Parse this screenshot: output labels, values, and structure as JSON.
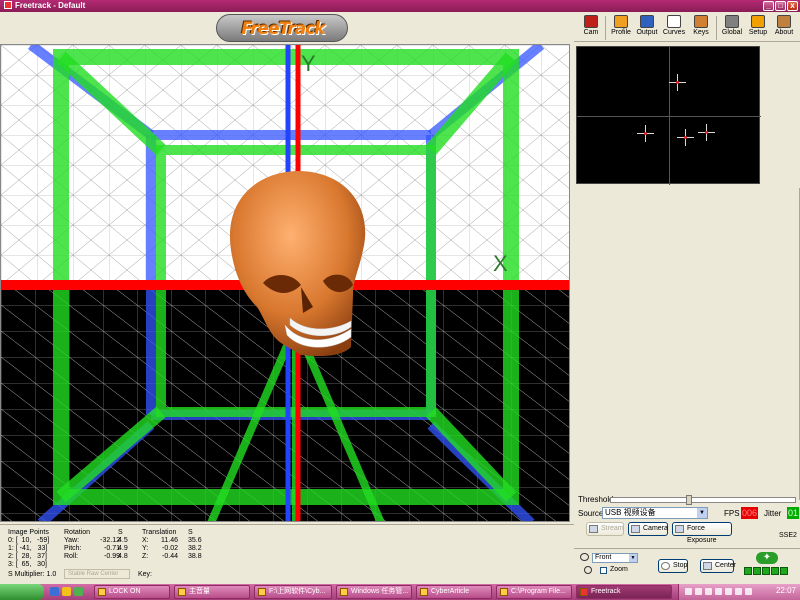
{
  "window": {
    "title": "Freetrack - Default",
    "buttons": [
      "_",
      "□",
      "x"
    ]
  },
  "logo": {
    "text": "FreeTrack"
  },
  "view3d": {
    "axis_y_label": "Y",
    "axis_x_label": "X",
    "colors": {
      "green": "#00cc00",
      "blue": "#2244ff",
      "red": "#ff0000",
      "skull": "#d9782f"
    }
  },
  "toolbar": {
    "items": [
      {
        "label": "Cam",
        "icon": "camera-icon",
        "color": "#c0201a"
      },
      {
        "label": "Profile",
        "icon": "profile-icon",
        "color": "#f0a020"
      },
      {
        "label": "Output",
        "icon": "output-icon",
        "color": "#3060c0"
      },
      {
        "label": "Curves",
        "icon": "curves-icon",
        "color": "#e04040"
      },
      {
        "label": "Keys",
        "icon": "keys-icon",
        "color": "#d08030"
      },
      {
        "label": "Global",
        "icon": "global-icon",
        "color": "#808080"
      },
      {
        "label": "Setup",
        "icon": "setup-icon",
        "color": "#f0a000"
      },
      {
        "label": "About",
        "icon": "about-icon",
        "color": "#c08040"
      }
    ]
  },
  "threshold": {
    "label": "Threshold",
    "level": 0.42
  },
  "source": {
    "label": "Source",
    "value": "USB 视频设备",
    "fps_label": "FPS",
    "fps_value": "006",
    "jitter_label": "Jitter",
    "jitter_value": "01"
  },
  "buttons": {
    "stream": "Stream",
    "camera": "Camera",
    "force_exposure": "Force Exposure",
    "sse2": "SSE2"
  },
  "status": {
    "image_points_title": "Image Points",
    "image_points": [
      "0: [  10,   -59]",
      "1: [ -41,   33]",
      "2: [  28,   37]",
      "3: [  65,   30]"
    ],
    "rotation_title": "Rotation",
    "rotation_s_title": "S",
    "rotation": [
      {
        "label": "Yaw:",
        "value": "-32.12",
        "s": "4.5"
      },
      {
        "label": "Pitch:",
        "value": "-0.71",
        "s": "4.9"
      },
      {
        "label": "Roll:",
        "value": "-0.99",
        "s": "4.8"
      }
    ],
    "translation_title": "Translation",
    "translation_s_title": "S",
    "translation": [
      {
        "label": "X:",
        "value": "11.46",
        "s": "35.6"
      },
      {
        "label": "Y:",
        "value": "-0.02",
        "s": "38.2"
      },
      {
        "label": "Z:",
        "value": "-0.44",
        "s": "38.8"
      }
    ],
    "s_multiplier_label": "S Multiplier:",
    "s_multiplier_value": "1.0",
    "stable_raw_center": "Stable  Raw  Center",
    "key_label": "Key:"
  },
  "bottom_controls": {
    "view_select": "Front",
    "zoom_label": "Zoom",
    "stop": "Stop",
    "center": "Center"
  },
  "taskbar": {
    "tasks": [
      {
        "label": "LOCK ON"
      },
      {
        "label": "主音量"
      },
      {
        "label": "F:\\上网软件\\Cyb..."
      },
      {
        "label": "Windows 任务管..."
      },
      {
        "label": "CyberArticle"
      },
      {
        "label": "C:\\Program File..."
      },
      {
        "label": "Freetrack"
      }
    ],
    "clock": "22:07"
  }
}
